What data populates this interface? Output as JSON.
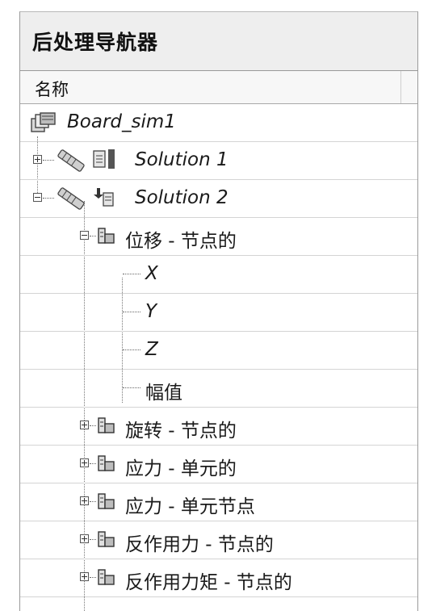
{
  "navigator": {
    "title": "后处理导航器",
    "column_header": "名称"
  },
  "tree": {
    "root": {
      "label": "Board_sim1",
      "icon": "sim-file-icon"
    },
    "solution1": {
      "label": "Solution 1",
      "icon": "solution-icon",
      "state": "collapsed"
    },
    "solution2": {
      "label": "Solution 2",
      "icon": "solution-active-icon",
      "state": "expanded"
    },
    "displacement": {
      "label": "位移 - 节点的",
      "icon": "result-icon",
      "state": "expanded"
    },
    "comp_x": {
      "label": "X"
    },
    "comp_y": {
      "label": "Y"
    },
    "comp_z": {
      "label": "Z"
    },
    "comp_mag": {
      "label": "幅值"
    },
    "rotation": {
      "label": "旋转 - 节点的",
      "state": "collapsed"
    },
    "stress_elem": {
      "label": "应力 - 单元的",
      "state": "collapsed"
    },
    "stress_elem_node": {
      "label": "应力 - 单元节点",
      "state": "collapsed"
    },
    "reaction_force": {
      "label": "反作用力 - 节点的",
      "state": "collapsed"
    },
    "reaction_moment": {
      "label": "反作用力矩 - 节点的",
      "state": "collapsed"
    }
  }
}
